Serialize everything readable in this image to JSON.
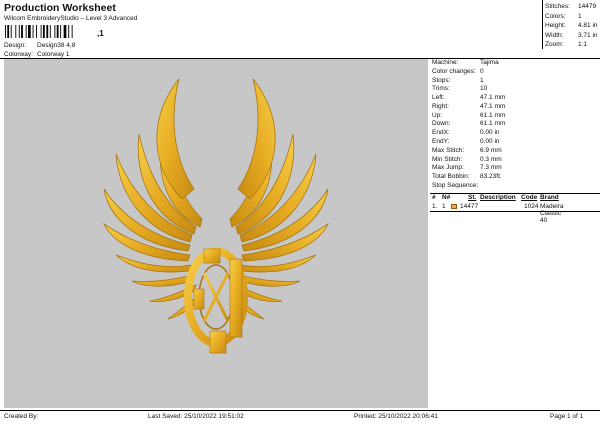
{
  "header": {
    "title": "Production Worksheet",
    "subtitle": "Wilcom EmbroideryStudio – Level 3 Advanced",
    "barcode_suffix": ",1"
  },
  "meta": {
    "design_label": "Design:",
    "design_value": "Design38 4,8",
    "colorway_label": "Colorway:",
    "colorway_value": "Colorway 1"
  },
  "stats": [
    {
      "label": "Stitches:",
      "value": "14479"
    },
    {
      "label": "Colors:",
      "value": "1"
    },
    {
      "label": "Height:",
      "value": "4.81 in"
    },
    {
      "label": "Width:",
      "value": "3.71 in"
    },
    {
      "label": "Zoom:",
      "value": "1:1"
    }
  ],
  "machine_info": [
    {
      "label": "Machine:",
      "value": "Tajima"
    },
    {
      "label": "Color changes:",
      "value": "0"
    },
    {
      "label": "Stops:",
      "value": "1"
    },
    {
      "label": "Trims:",
      "value": "10"
    },
    {
      "label": "Left:",
      "value": "47.1 mm"
    },
    {
      "label": "Right:",
      "value": "47.1 mm"
    },
    {
      "label": "Up:",
      "value": "61.1 mm"
    },
    {
      "label": "Down:",
      "value": "61.1 mm"
    },
    {
      "label": "EndX:",
      "value": "0.00 in"
    },
    {
      "label": "EndY:",
      "value": "0.00 in"
    },
    {
      "label": "Max Stitch:",
      "value": "6.9 mm"
    },
    {
      "label": "Min Stitch:",
      "value": "0.3 mm"
    },
    {
      "label": "Max Jump:",
      "value": "7.3 mm"
    },
    {
      "label": "Total Bobbin:",
      "value": "83.23ft."
    },
    {
      "label": "Stop Sequence:",
      "value": ""
    }
  ],
  "stop_table": {
    "headers": [
      "#",
      "N#",
      "St.",
      "Description",
      "Code",
      "Brand"
    ],
    "rows": [
      {
        "num": "1.",
        "n": "1",
        "stitches": "14477",
        "description": "",
        "code": "1024",
        "brand": "Madeira Classic 40",
        "color": "#f2a93b"
      }
    ]
  },
  "footer": {
    "created_by": "Created By:",
    "last_saved": "Last Saved: 25/10/2022 19:51:02",
    "printed": "Printed: 25/10/2022 20:06:41",
    "page": "Page 1 of 1"
  },
  "colors": {
    "canvas_bg": "#c7c7c7",
    "thread_gold": "#e8b22f",
    "thread_dark": "#9c6f10"
  }
}
